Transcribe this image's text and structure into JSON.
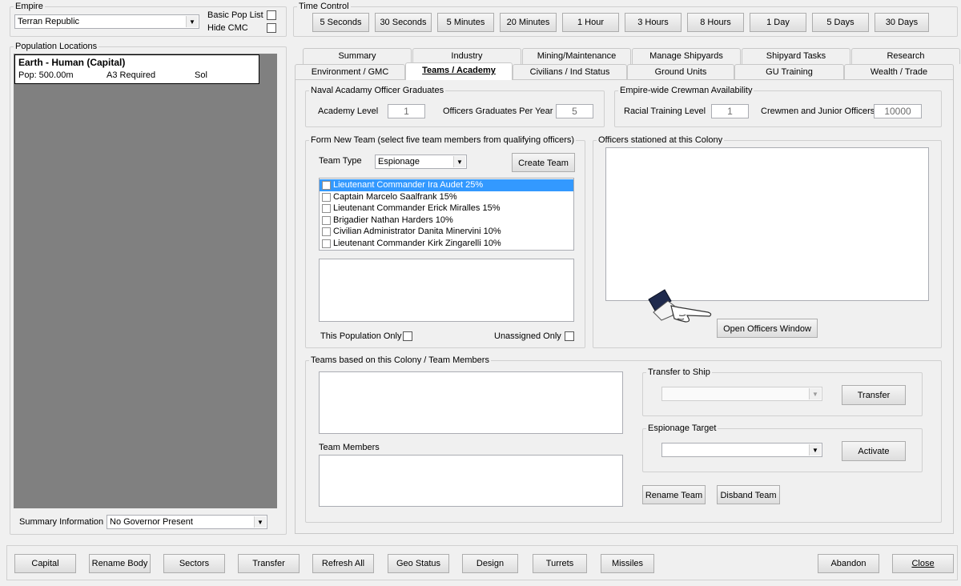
{
  "empire": {
    "label": "Empire",
    "selected": "Terran Republic",
    "basic_pop_list": "Basic Pop List",
    "hide_cmc": "Hide CMC"
  },
  "time_control": {
    "label": "Time Control",
    "buttons": [
      "5 Seconds",
      "30 Seconds",
      "5 Minutes",
      "20 Minutes",
      "1 Hour",
      "3 Hours",
      "8 Hours",
      "1 Day",
      "5 Days",
      "30 Days"
    ]
  },
  "population": {
    "label": "Population Locations",
    "item": {
      "title": "Earth - Human (Capital)",
      "pop": "Pop: 500.00m",
      "required": "A3 Required",
      "system": "Sol"
    }
  },
  "summary_info": {
    "label": "Summary Information",
    "governor": "No Governor Present"
  },
  "tabs": {
    "row1": [
      "Summary",
      "Industry",
      "Mining/Maintenance",
      "Manage Shipyards",
      "Shipyard Tasks",
      "Research"
    ],
    "row2": [
      "Environment / GMC",
      "Teams / Academy",
      "Civilians / Ind Status",
      "Ground Units",
      "GU Training",
      "Wealth / Trade"
    ]
  },
  "academy": {
    "label": "Naval Acadamy Officer Graduates",
    "level_label": "Academy Level",
    "level_value": "1",
    "grads_label": "Officers Graduates Per Year",
    "grads_value": "5"
  },
  "crewman": {
    "label": "Empire-wide Crewman Availability",
    "racial_label": "Racial Training Level",
    "racial_value": "1",
    "crew_label": "Crewmen and Junior Officers",
    "crew_value": "10000"
  },
  "form_team": {
    "label": "Form New Team (select five team members from qualifying officers)",
    "type_label": "Team Type",
    "type_value": "Espionage",
    "create_button": "Create Team",
    "officers": [
      "Lieutenant Commander Ira Audet  25%",
      "Captain Marcelo Saalfrank  15%",
      "Lieutenant Commander Erick Miralles  15%",
      "Brigadier Nathan Harders  10%",
      "Civilian Administrator Danita Minervini  10%",
      "Lieutenant Commander Kirk Zingarelli  10%"
    ],
    "this_population_only": "This Population Only",
    "unassigned_only": "Unassigned Only"
  },
  "officers_stationed": {
    "label": "Officers stationed at this Colony",
    "open_button": "Open Officers Window"
  },
  "teams_colony": {
    "label": "Teams based on this Colony / Team Members",
    "team_members_label": "Team Members",
    "transfer_label": "Transfer to Ship",
    "transfer_button": "Transfer",
    "espionage_label": "Espionage Target",
    "activate_button": "Activate",
    "rename_button": "Rename Team",
    "disband_button": "Disband Team"
  },
  "bottom_bar": {
    "buttons": [
      "Capital",
      "Rename Body",
      "Sectors",
      "Transfer",
      "Refresh All",
      "Geo Status",
      "Design",
      "Turrets",
      "Missiles"
    ],
    "abandon": "Abandon",
    "close": "Close"
  },
  "colors": {
    "window_bg": "#f0f0f0",
    "selection": "#3399ff",
    "pop_list_bg": "#808080"
  },
  "icons": [
    "pointing-hand-icon",
    "dropdown-arrow-icon"
  ]
}
